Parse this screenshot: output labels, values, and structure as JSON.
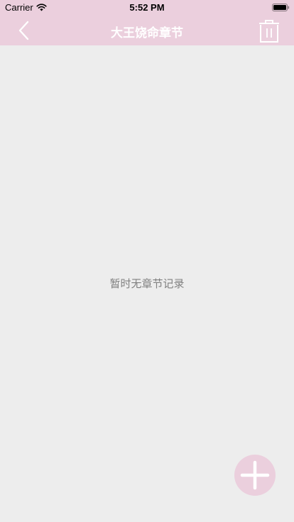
{
  "status_bar": {
    "carrier": "Carrier",
    "time": "5:52 PM"
  },
  "nav": {
    "title": "大王饶命章节",
    "back_icon": "chevron-left-icon",
    "trash_icon": "trash-icon"
  },
  "empty_state": {
    "message": "暂时无章节记录"
  },
  "fab": {
    "icon": "plus-icon"
  },
  "colors": {
    "bar_bg": "#ebcfdd",
    "page_bg": "#ededed",
    "title_text": "#ffffff",
    "empty_text": "#808080"
  }
}
